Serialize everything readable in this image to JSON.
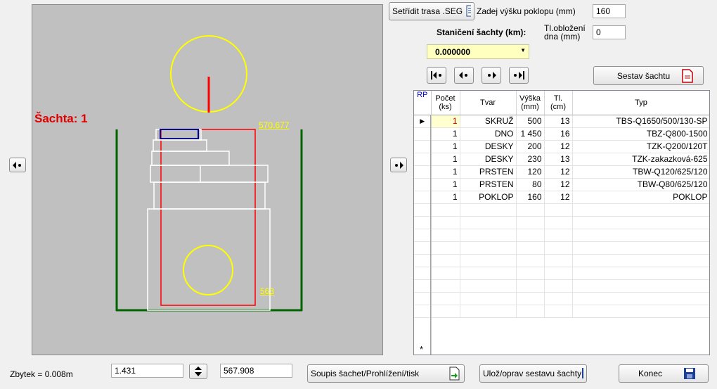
{
  "canvas": {
    "title": "Šachta: 1",
    "top_elevation": "570.677",
    "bottom_elevation": "563"
  },
  "top": {
    "sort_button": "Setřídit trasa .SEG",
    "lid_height_label": "Zadej  výšku poklopu (mm)",
    "lid_height_value": "160",
    "stationing_label": "Staničení šachty (km):",
    "stationing_value": "0.000000",
    "floor_thickness_label": "Tl.obložení dna (mm)",
    "floor_thickness_value": "0",
    "assemble_button": "Sestav šachtu"
  },
  "grid": {
    "columns": [
      "RP",
      "Počet (ks)",
      "Tvar",
      "Výška (mm)",
      "Tl. (cm)",
      "Typ"
    ],
    "rows": [
      {
        "count": "1",
        "shape": "SKRUŽ",
        "height": "500",
        "thick": "13",
        "type": "TBS-Q1650/500/130-SP"
      },
      {
        "count": "1",
        "shape": "DNO",
        "height": "1 450",
        "thick": "16",
        "type": "TBZ-Q800-1500"
      },
      {
        "count": "1",
        "shape": "DESKY",
        "height": "200",
        "thick": "12",
        "type": "TZK-Q200/120T"
      },
      {
        "count": "1",
        "shape": "DESKY",
        "height": "230",
        "thick": "13",
        "type": "TZK-zakazková-625"
      },
      {
        "count": "1",
        "shape": "PRSTEN",
        "height": "120",
        "thick": "12",
        "type": "TBW-Q120/625/120"
      },
      {
        "count": "1",
        "shape": "PRSTEN",
        "height": "80",
        "thick": "12",
        "type": "TBW-Q80/625/120"
      },
      {
        "count": "1",
        "shape": "POKLOP",
        "height": "160",
        "thick": "12",
        "type": "POKLOP"
      }
    ],
    "new_row_marker": "*",
    "current_row_marker": "▶"
  },
  "bottom": {
    "remainder_label": "Zbytek =  0.008m",
    "value1": "1.431",
    "value2": "567.908",
    "list_button": "Soupis šachet/Prohlížení/tisk",
    "save_button": "Ulož/oprav sestavu šachty",
    "exit_button": "Konec"
  },
  "colors": {
    "canvas_bg": "#c0c0c0",
    "title_red": "#e00000",
    "elevation_yellow": "#ffff00",
    "shaft_green": "#006400",
    "stationing_bg": "#ffffc0"
  }
}
